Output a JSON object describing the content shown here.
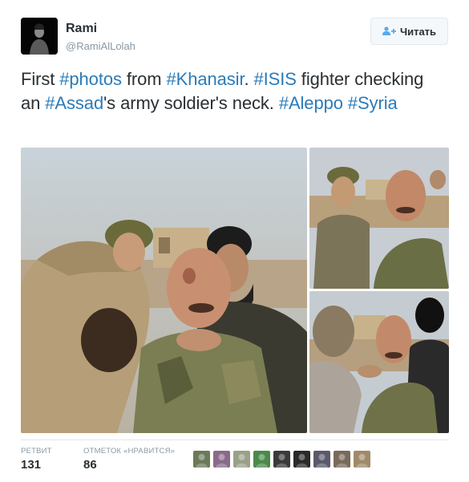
{
  "user": {
    "name": "Rami",
    "handle": "@RamiAlLolah"
  },
  "follow_button": {
    "label": "Читать"
  },
  "tweet": {
    "segments": [
      {
        "text": "First ",
        "hashtag": false
      },
      {
        "text": "#photos",
        "hashtag": true
      },
      {
        "text": " from ",
        "hashtag": false
      },
      {
        "text": "#Khanasir",
        "hashtag": true
      },
      {
        "text": ". ",
        "hashtag": false
      },
      {
        "text": "#ISIS",
        "hashtag": true
      },
      {
        "text": " fighter checking an ",
        "hashtag": false
      },
      {
        "text": "#Assad",
        "hashtag": true
      },
      {
        "text": "'s army soldier's neck. ",
        "hashtag": false
      },
      {
        "text": "#Aleppo",
        "hashtag": true
      },
      {
        "text": " ",
        "hashtag": false
      },
      {
        "text": "#Syria",
        "hashtag": true
      }
    ]
  },
  "stats": {
    "retweets_label": "РЕТВИТ",
    "retweets": "131",
    "likes_label": "ОТМЕТОК «НРАВИТСЯ»",
    "likes": "86"
  },
  "liker_avatars": [
    {
      "name": "liker-avatar-1",
      "color": "#6a7a5a"
    },
    {
      "name": "liker-avatar-2",
      "color": "#8a6a8a"
    },
    {
      "name": "liker-avatar-3",
      "color": "#9aa08a"
    },
    {
      "name": "liker-avatar-4",
      "color": "#4a8a4a"
    },
    {
      "name": "liker-avatar-5",
      "color": "#3a3a3a"
    },
    {
      "name": "liker-avatar-6",
      "color": "#2a2a2a"
    },
    {
      "name": "liker-avatar-7",
      "color": "#5a5a6a"
    },
    {
      "name": "liker-avatar-8",
      "color": "#7a6a5a"
    },
    {
      "name": "liker-avatar-9",
      "color": "#a08a6a"
    }
  ],
  "colors": {
    "hashtag": "#2b7bb9",
    "accent": "#55acee",
    "muted": "#8899a6",
    "border": "#e1e8ed"
  }
}
